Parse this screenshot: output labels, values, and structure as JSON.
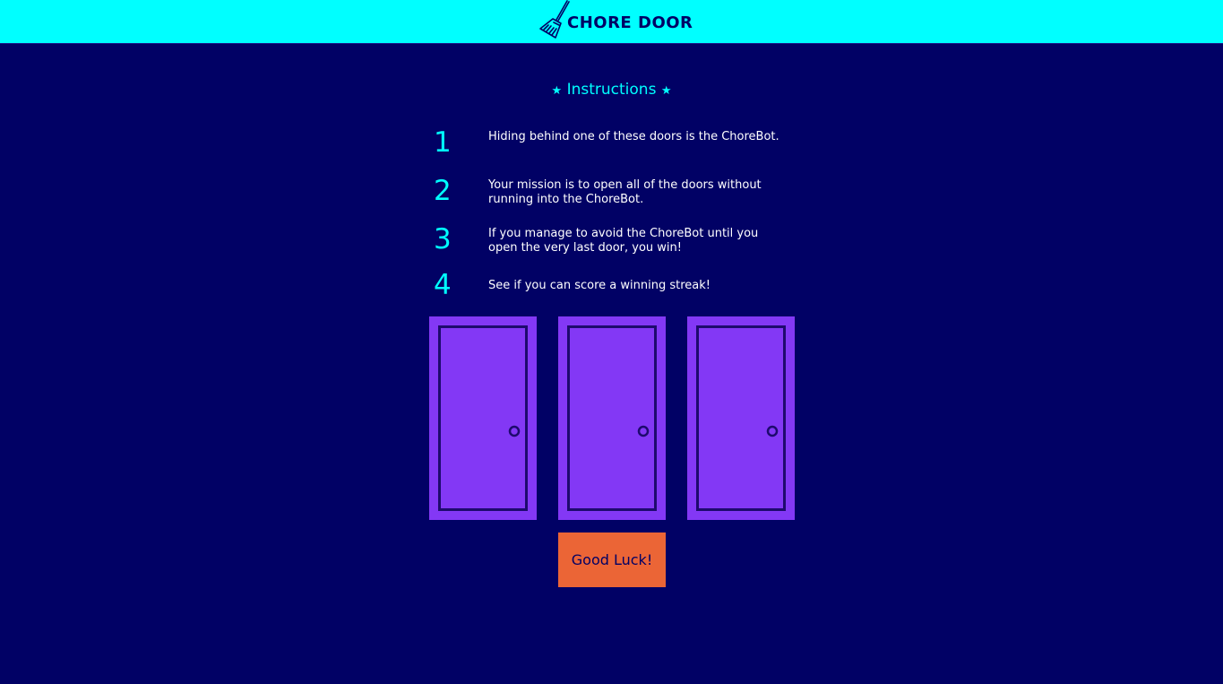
{
  "header": {
    "title": "CHORE DOOR",
    "logo_icon": "broom-icon",
    "background_color": "#00ffff"
  },
  "instructions": {
    "title": "Instructions",
    "star_glyph": "★",
    "items": [
      {
        "number": "1",
        "text": "Hiding behind one of these doors is the ChoreBot."
      },
      {
        "number": "2",
        "text": "Your mission is to open all of the doors without running into the ChoreBot."
      },
      {
        "number": "3",
        "text": "If you manage to avoid the ChoreBot until you open the very last door, you win!"
      },
      {
        "number": "4",
        "text": "See if you can score a winning streak!"
      }
    ]
  },
  "doors": [
    {
      "state": "closed",
      "icon": "closed-door-icon"
    },
    {
      "state": "closed",
      "icon": "closed-door-icon"
    },
    {
      "state": "closed",
      "icon": "closed-door-icon"
    }
  ],
  "start_button": {
    "label": "Good Luck!"
  },
  "colors": {
    "background": "#010165",
    "accent": "#00ffff",
    "door": "#8338f5",
    "button": "#eb6536",
    "text": "#ffffff"
  }
}
